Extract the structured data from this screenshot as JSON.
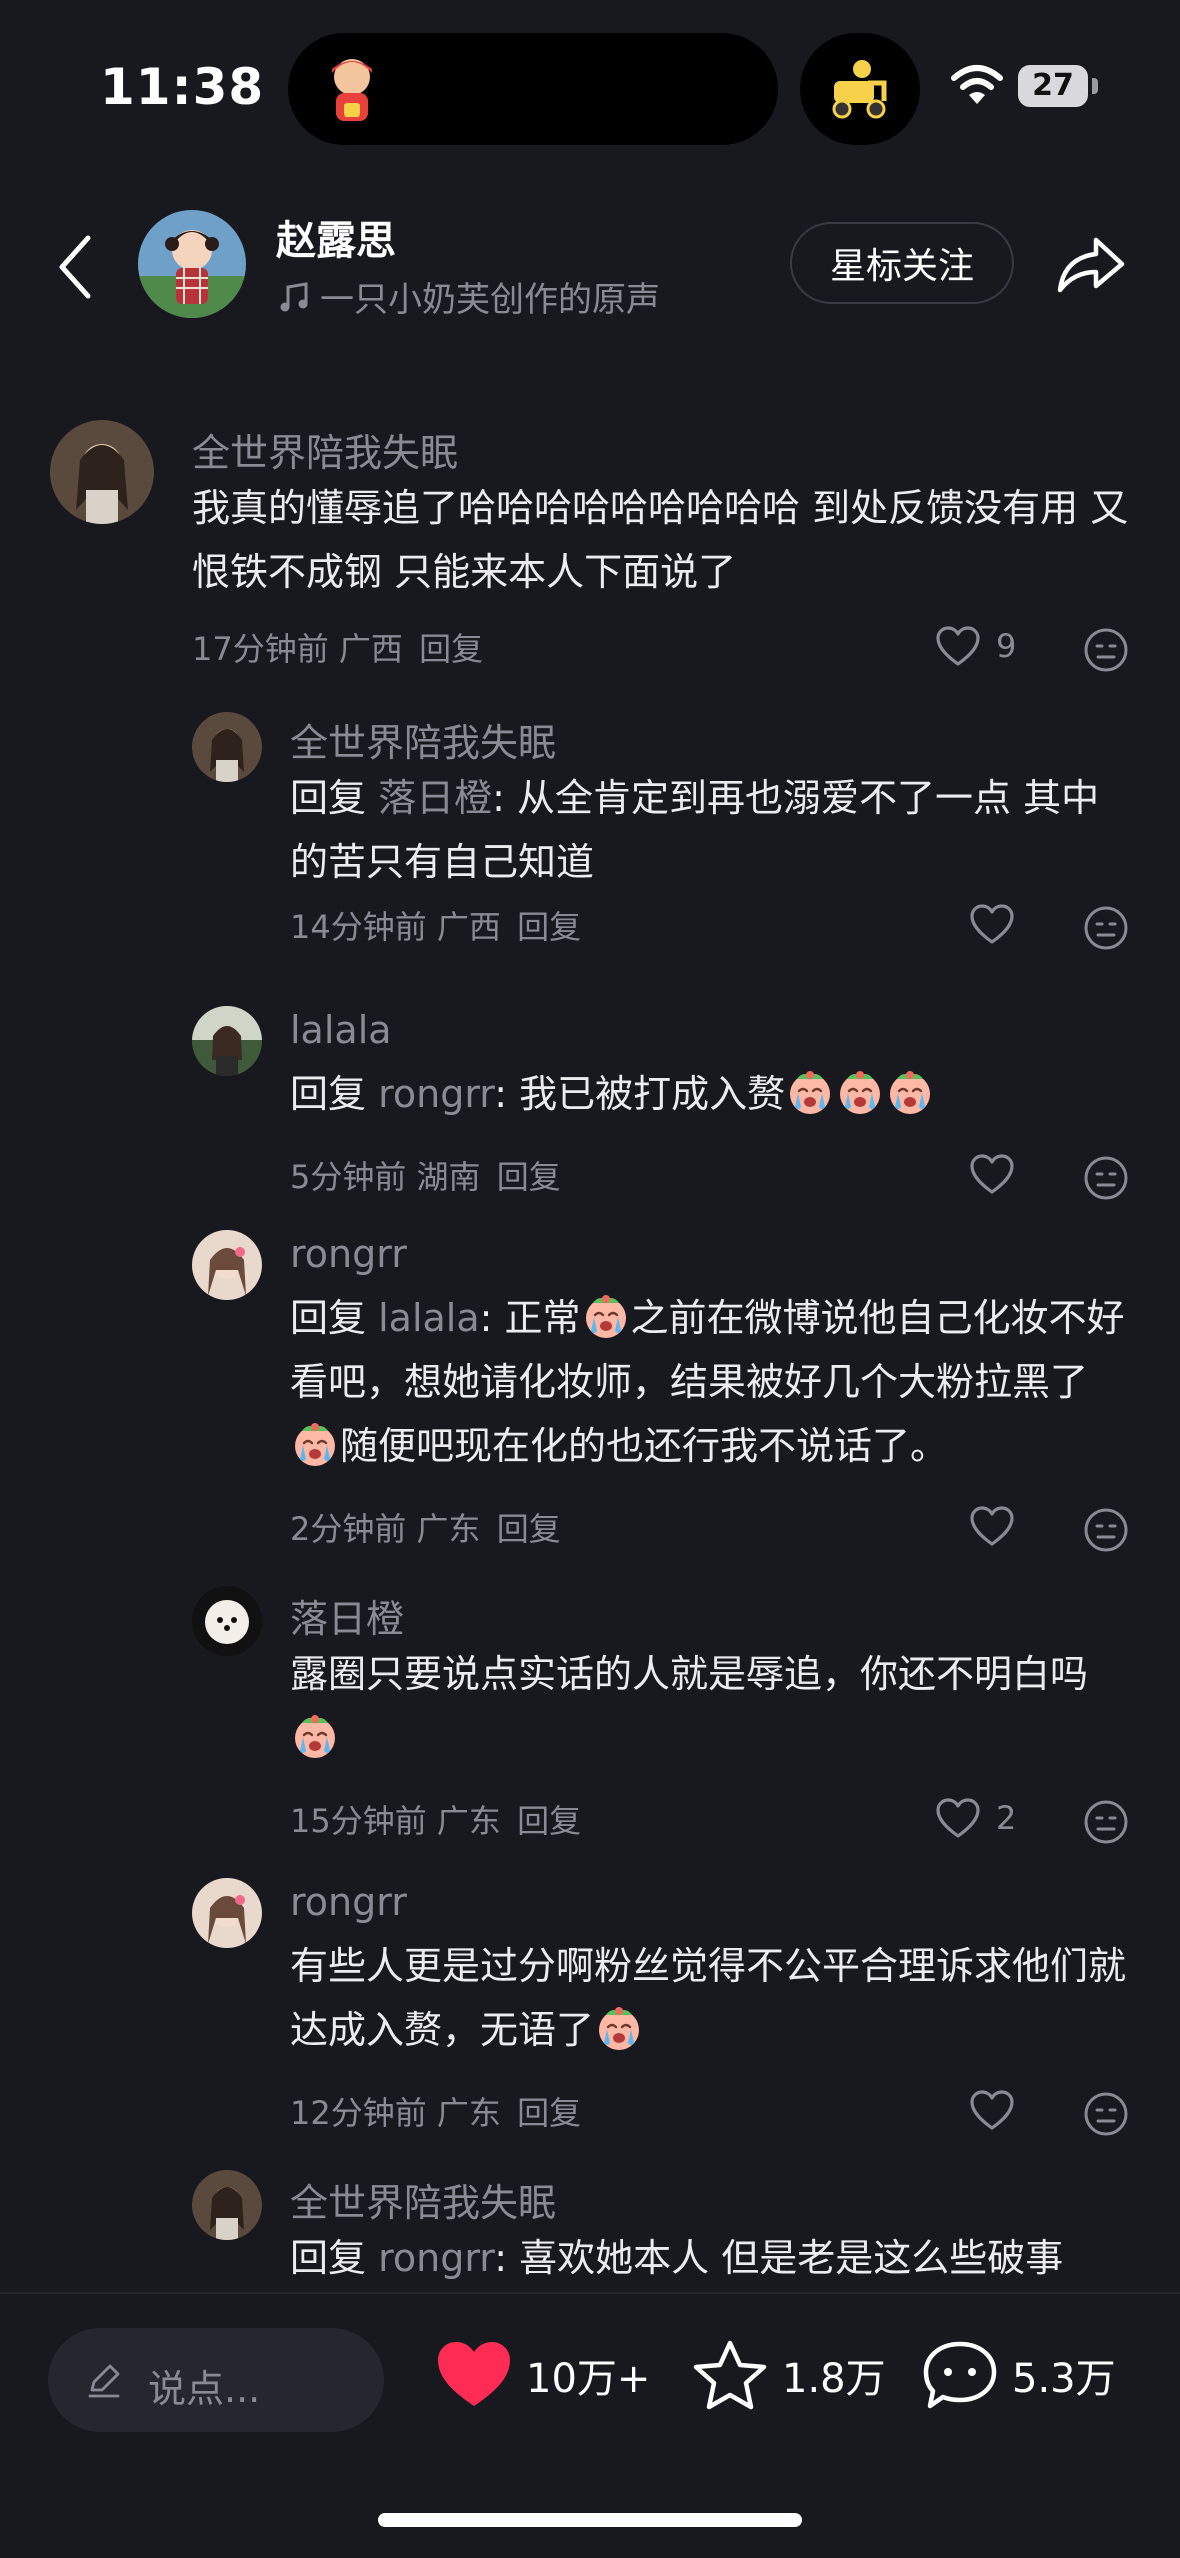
{
  "status_bar": {
    "time": "11:38",
    "battery": "27"
  },
  "header": {
    "name": "赵露思",
    "subtitle": "一只小奶芙创作的原声",
    "follow_label": "星标关注"
  },
  "comments": [
    {
      "user": "全世界陪我失眠",
      "text": "我真的懂辱追了哈哈哈哈哈哈哈哈哈 到处反馈没有用 又恨铁不成钢 只能来本人下面说了",
      "time": "17分钟前",
      "location": "广西",
      "reply_label": "回复",
      "likes": "9"
    },
    {
      "user": "全世界陪我失眠",
      "reply_prefix": "回复",
      "reply_to": "落日橙",
      "text": ": 从全肯定到再也溺爱不了一点 其中的苦只有自己知道",
      "time": "14分钟前",
      "location": "广西",
      "reply_label": "回复",
      "likes": ""
    },
    {
      "user": "lalala",
      "reply_prefix": "回复",
      "reply_to": "rongrr",
      "text": ": 我已被打成入赘",
      "time": "5分钟前",
      "location": "湖南",
      "reply_label": "回复",
      "likes": ""
    },
    {
      "user": "rongrr",
      "reply_prefix": "回复",
      "reply_to": "lalala",
      "text_a": ": 正常",
      "text_b": "之前在微博说他自己化妆不好看吧，想她请化妆师，结果被好几个大粉拉黑了",
      "text_c": "随便吧现在化的也还行我不说话了。",
      "time": "2分钟前",
      "location": "广东",
      "reply_label": "回复",
      "likes": ""
    },
    {
      "user": "落日橙",
      "text": "露圈只要说点实话的人就是辱追，你还不明白吗",
      "time": "15分钟前",
      "location": "广东",
      "reply_label": "回复",
      "likes": "2"
    },
    {
      "user": "rongrr",
      "text": "有些人更是过分啊粉丝觉得不公平合理诉求他们就达成入赘，无语了",
      "time": "12分钟前",
      "location": "广东",
      "reply_label": "回复",
      "likes": ""
    },
    {
      "user": "全世界陪我失眠",
      "reply_prefix": "回复",
      "reply_to": "rongrr",
      "text": ": 喜欢她本人 但是老是这么些破事"
    }
  ],
  "bottom_bar": {
    "input_placeholder": "说点...",
    "likes": "10万+",
    "favorites": "1.8万",
    "comments": "5.3万"
  },
  "colors": {
    "background": "#18181f",
    "like_red": "#fe2c55",
    "muted": "#8a8a94"
  }
}
